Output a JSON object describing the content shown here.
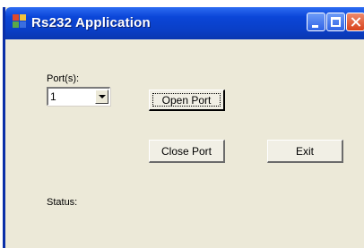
{
  "window": {
    "title": "Rs232 Application",
    "icon": "app-window-icon",
    "controls": [
      "minimize-icon",
      "maximize-icon",
      "close-icon"
    ]
  },
  "form": {
    "port_label": "Port(s):",
    "port_selected": "1",
    "open_port_label": "Open Port",
    "close_port_label": "Close Port",
    "exit_label": "Exit",
    "status_label": "Status:"
  },
  "colors": {
    "titlebar": "#0b46d8",
    "window_bg": "#ece9d8",
    "close_button": "#d8421c"
  }
}
